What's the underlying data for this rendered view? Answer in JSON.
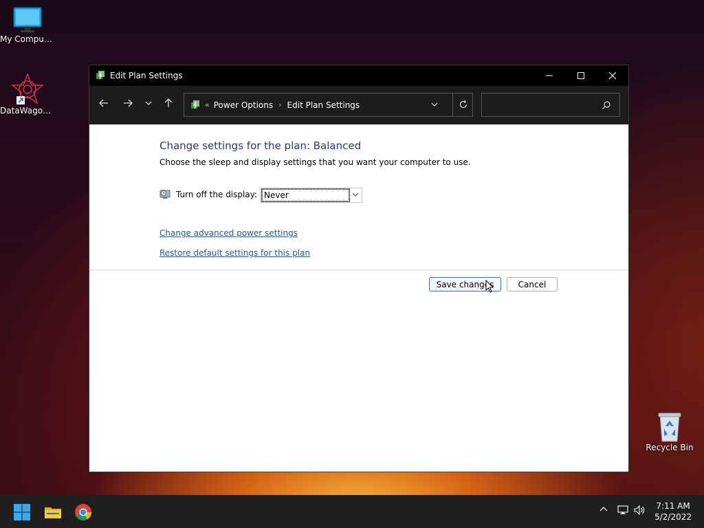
{
  "desktop": {
    "icons": [
      {
        "label": "My Computer",
        "icon": "monitor-icon"
      },
      {
        "label": "DataWagon...",
        "icon": "datawagon-icon"
      },
      {
        "label": "Recycle Bin",
        "icon": "recycle-bin-icon"
      }
    ]
  },
  "window": {
    "title": "Edit Plan Settings",
    "controls": {
      "minimize": "—",
      "maximize": "☐",
      "close": "✕"
    },
    "address": {
      "overflow": "«",
      "crumbs": [
        "Power Options",
        "Edit Plan Settings"
      ],
      "separator": "›"
    },
    "search": {
      "placeholder": ""
    }
  },
  "content": {
    "heading": "Change settings for the plan: Balanced",
    "subtext": "Choose the sleep and display settings that you want your computer to use.",
    "display_label": "Turn off the display:",
    "display_value": "Never",
    "link_advanced": "Change advanced power settings",
    "link_restore": "Restore default settings for this plan",
    "save_label": "Save changes",
    "cancel_label": "Cancel"
  },
  "taskbar": {
    "time": "7:11 AM",
    "date": "5/2/2022"
  },
  "colors": {
    "heading": "#1f3d7a",
    "link": "#1c5a9c",
    "titlebar": "#000000",
    "navbar": "#1c1c1c",
    "taskbar": "#1f1f1f"
  }
}
